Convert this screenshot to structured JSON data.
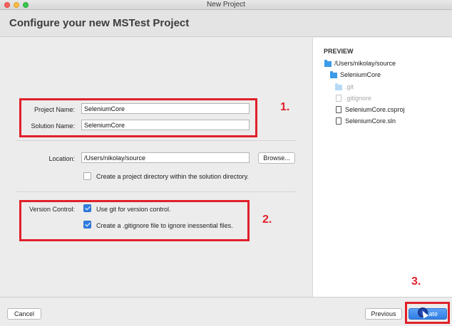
{
  "window": {
    "title": "New Project"
  },
  "header": {
    "title": "Configure your new MSTest Project"
  },
  "form": {
    "project_name_label": "Project Name:",
    "project_name_value": "SeleniumCore",
    "solution_name_label": "Solution Name:",
    "solution_name_value": "SeleniumCore",
    "location_label": "Location:",
    "location_value": "/Users/nikolay/source",
    "browse_label": "Browse...",
    "create_dir_label": "Create a project directory within the solution directory.",
    "create_dir_checked": false,
    "version_control_label": "Version Control:",
    "use_git_label": "Use git for version control.",
    "use_git_checked": true,
    "gitignore_label": "Create a .gitignore file to ignore inessential files.",
    "gitignore_checked": true
  },
  "preview": {
    "title": "PREVIEW",
    "items": [
      {
        "label": "/Users/nikolay/source",
        "icon": "folder-icon"
      },
      {
        "label": "SeleniumCore",
        "icon": "folder-icon"
      },
      {
        "label": ".git",
        "icon": "folder-icon"
      },
      {
        "label": ".gitignore",
        "icon": "file-icon"
      },
      {
        "label": "SeleniumCore.csproj",
        "icon": "file-icon"
      },
      {
        "label": "SeleniumCore.sln",
        "icon": "file-icon"
      }
    ]
  },
  "footer": {
    "cancel_label": "Cancel",
    "previous_label": "Previous",
    "create_label": "Create",
    "create_visible_text": "ate"
  },
  "annotations": {
    "one": "1.",
    "two": "2.",
    "three": "3.",
    "color": "#e0202a"
  },
  "colors": {
    "accent": "#2f7de1",
    "folder": "#3d9be9"
  }
}
